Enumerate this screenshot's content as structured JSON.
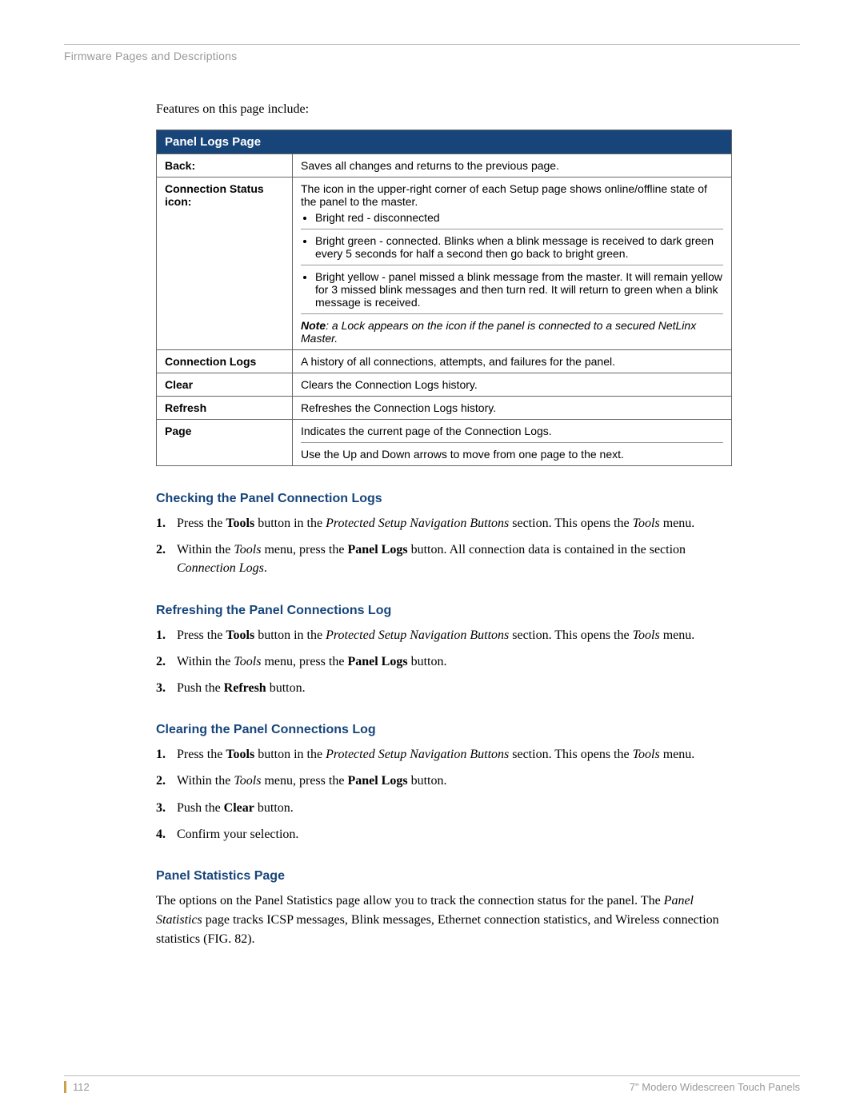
{
  "header": "Firmware Pages and Descriptions",
  "intro": "Features on this page include:",
  "table": {
    "title": "Panel Logs Page",
    "rows": {
      "back": {
        "label": "Back:",
        "desc": "Saves all changes and returns to the previous page."
      },
      "conn_status": {
        "label": "Connection Status icon:",
        "desc": "The icon in the upper-right corner of each Setup page shows online/offline state of the panel to the master.",
        "bullets": [
          "Bright red - disconnected",
          "Bright green - connected. Blinks when a blink message is received to dark green every 5 seconds for half a second then go back to bright green.",
          "Bright yellow - panel missed a blink message from the master. It will remain yellow for 3 missed blink messages and then turn red. It will return to green when a blink message is received."
        ],
        "note_label": "Note",
        "note": ": a Lock appears on the icon if the panel is connected to a secured NetLinx Master."
      },
      "conn_logs": {
        "label": "Connection Logs",
        "desc": "A history of all connections, attempts, and failures for the panel."
      },
      "clear": {
        "label": "Clear",
        "desc": "Clears the Connection Logs history."
      },
      "refresh": {
        "label": "Refresh",
        "desc": "Refreshes the Connection Logs history."
      },
      "page": {
        "label": "Page",
        "desc1": "Indicates the current page of the Connection Logs.",
        "desc2": "Use the Up and Down arrows to move from one page to the next."
      }
    }
  },
  "sections": {
    "checking": {
      "title": "Checking the Panel Connection Logs",
      "s1a": "Press the ",
      "s1b": "Tools",
      "s1c": " button in the ",
      "s1d": "Protected Setup Navigation Buttons",
      "s1e": " section. This opens the ",
      "s1f": "Tools",
      "s1g": " menu.",
      "s2a": "Within the ",
      "s2b": "Tools",
      "s2c": " menu, press the ",
      "s2d": "Panel Logs",
      "s2e": " button. All connection data is contained in the section ",
      "s2f": "Connection Logs",
      "s2g": "."
    },
    "refreshing": {
      "title": "Refreshing the Panel Connections Log",
      "s1a": "Press the ",
      "s1b": "Tools",
      "s1c": " button in the ",
      "s1d": "Protected Setup Navigation Buttons",
      "s1e": " section. This opens the ",
      "s1f": "Tools",
      "s1g": " menu.",
      "s2a": "Within the ",
      "s2b": "Tools",
      "s2c": " menu, press the ",
      "s2d": "Panel Logs",
      "s2e": " button.",
      "s3a": "Push the ",
      "s3b": "Refresh",
      "s3c": " button."
    },
    "clearing": {
      "title": "Clearing the Panel Connections Log",
      "s1a": "Press the ",
      "s1b": "Tools",
      "s1c": " button in the ",
      "s1d": "Protected Setup Navigation Buttons",
      "s1e": " section. This opens the ",
      "s1f": "Tools",
      "s1g": " menu.",
      "s2a": "Within the ",
      "s2b": "Tools",
      "s2c": " menu, press the ",
      "s2d": "Panel Logs",
      "s2e": " button.",
      "s3a": "Push the ",
      "s3b": "Clear",
      "s3c": " button.",
      "s4": "Confirm your selection."
    },
    "stats": {
      "title": "Panel Statistics Page",
      "p1a": "The options on the Panel Statistics page allow you to track the connection status for the panel. The ",
      "p1b": "Panel Statistics",
      "p1c": " page tracks ICSP messages, Blink messages, Ethernet connection statistics, and Wireless connection statistics (FIG. 82)."
    }
  },
  "footer": {
    "page_number": "112",
    "doc_title": "7\" Modero Widescreen Touch Panels"
  }
}
